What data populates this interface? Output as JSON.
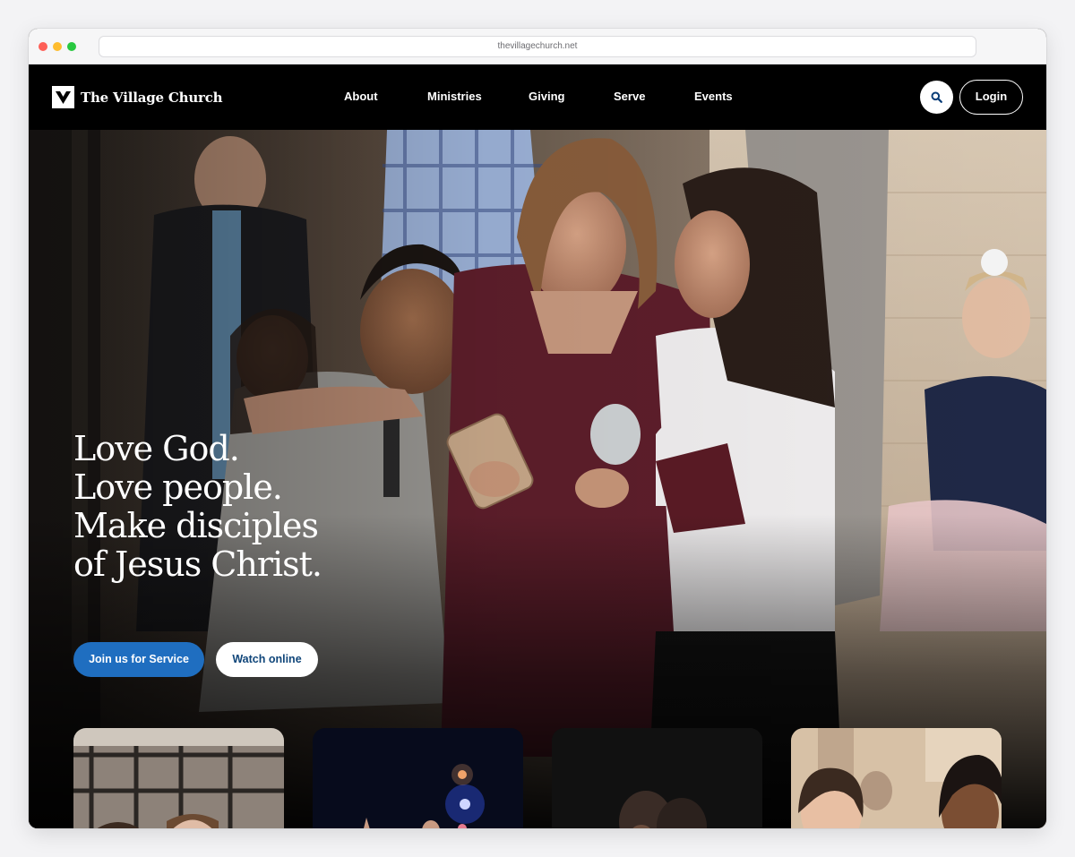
{
  "browser": {
    "url": "thevillagechurch.net"
  },
  "header": {
    "logo_text": "The Village Church",
    "nav": [
      {
        "label": "About"
      },
      {
        "label": "Ministries"
      },
      {
        "label": "Giving"
      },
      {
        "label": "Serve"
      },
      {
        "label": "Events"
      }
    ],
    "search_icon": "search-icon",
    "login_label": "Login"
  },
  "hero": {
    "headline_lines": [
      "Love God.",
      "Love people.",
      "Make disciples",
      "of Jesus Christ."
    ],
    "primary_cta": "Join us for Service",
    "secondary_cta": "Watch online"
  },
  "cards": [
    {
      "name": "card-entrance"
    },
    {
      "name": "card-worship"
    },
    {
      "name": "card-prayer"
    },
    {
      "name": "card-friends"
    }
  ],
  "colors": {
    "header_bg": "#000000",
    "primary_button": "#1f6ec0",
    "secondary_button_text": "#10467a"
  }
}
